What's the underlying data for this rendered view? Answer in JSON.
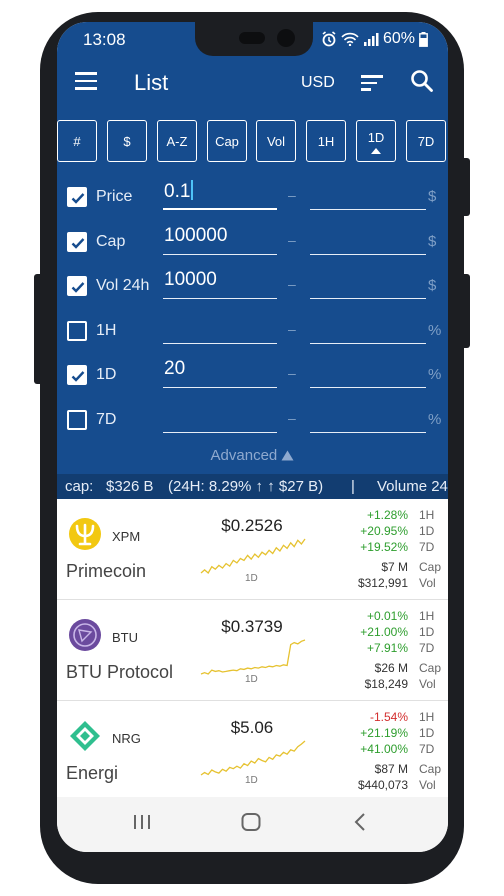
{
  "status": {
    "time": "13:08",
    "battery": "60%"
  },
  "appbar": {
    "title": "List",
    "currency": "USD"
  },
  "sort_buttons": [
    {
      "label": "#"
    },
    {
      "label": "$"
    },
    {
      "label": "A-Z"
    },
    {
      "label": "Cap"
    },
    {
      "label": "Vol"
    },
    {
      "label": "1H"
    },
    {
      "label": "1D",
      "active": true
    },
    {
      "label": "7D"
    }
  ],
  "filters": [
    {
      "label": "Price",
      "checked": true,
      "min": "0.1",
      "unit": "$"
    },
    {
      "label": "Cap",
      "checked": true,
      "min": "100000",
      "unit": "$"
    },
    {
      "label": "Vol 24h",
      "checked": true,
      "min": "10000",
      "unit": "$"
    },
    {
      "label": "1H",
      "checked": false,
      "min": "",
      "unit": "%"
    },
    {
      "label": "1D",
      "checked": true,
      "min": "20",
      "unit": "%"
    },
    {
      "label": "7D",
      "checked": false,
      "min": "",
      "unit": "%"
    }
  ],
  "filter_dash": "–",
  "advanced_label": "Advanced",
  "ticker": {
    "cap_label": "cap:",
    "cap_value": "$326 B",
    "change": "(24H: 8.29% ↑ ↑ $27 B)",
    "sep": "|",
    "volume_label": "Volume 24"
  },
  "coins": [
    {
      "symbol": "XPM",
      "name": "Primecoin",
      "price": "$0.2526",
      "spark_label": "1D",
      "h1": "+1.28%",
      "d1": "+20.95%",
      "d7": "+19.52%",
      "cap": "$7 M",
      "vol": "$312,991",
      "spark": [
        3,
        3.5,
        3,
        4,
        3.6,
        4.2,
        3.8,
        4.5,
        4.1,
        5,
        4.6,
        5.3,
        5,
        5.8,
        5.2,
        6,
        5.5,
        6.3,
        5.9,
        6.6,
        6.1,
        7,
        6.5,
        7.4,
        6.9,
        7.8,
        7.2,
        8.2,
        7.6,
        8.4
      ]
    },
    {
      "symbol": "BTU",
      "name": "BTU Protocol",
      "price": "$0.3739",
      "spark_label": "1D",
      "h1": "+0.01%",
      "d1": "+21.00%",
      "d7": "+7.91%",
      "cap": "$26 M",
      "vol": "$18,249",
      "spark": [
        3,
        3.2,
        3,
        3.6,
        3.4,
        3.5,
        3.3,
        3.4,
        3.5,
        3.6,
        3.5,
        3.8,
        3.7,
        3.9,
        3.8,
        4,
        3.9,
        4.1,
        4,
        4.2,
        4.1,
        4.3,
        4.2,
        4.4,
        4.3,
        7.5,
        7.8,
        7.6,
        8,
        8.2
      ]
    },
    {
      "symbol": "NRG",
      "name": "Energi",
      "price": "$5.06",
      "spark_label": "1D",
      "h1": "-1.54%",
      "d1": "+21.19%",
      "d7": "+41.00%",
      "cap": "$87 M",
      "vol": "$440,073",
      "spark": [
        3,
        3.4,
        3.1,
        3.8,
        3.5,
        3.3,
        3.9,
        3.6,
        4.2,
        4,
        4.4,
        4.1,
        4.8,
        4.5,
        5.2,
        4.9,
        5.6,
        5.3,
        5.1,
        5.8,
        5.5,
        6.2,
        6,
        6.6,
        6.3,
        7,
        6.8,
        7.5,
        7.9,
        8.4
      ]
    }
  ],
  "row_labels": {
    "h1": "1H",
    "d1": "1D",
    "d7": "7D",
    "cap": "Cap",
    "vol": "Vol"
  },
  "colors": {
    "primary": "#164c8e",
    "ticker_bg": "#123d71",
    "positive": "#2e9e2e",
    "negative": "#d32f2f",
    "spark": "#e6c230",
    "caret": "#4fc3f7"
  },
  "icons": [
    "menu-icon",
    "sort-icon",
    "search-icon",
    "alarm-icon",
    "wifi-icon",
    "signal-icon",
    "battery-icon",
    "check-icon",
    "caret-up-icon",
    "recent-apps-icon",
    "home-icon",
    "back-icon"
  ]
}
